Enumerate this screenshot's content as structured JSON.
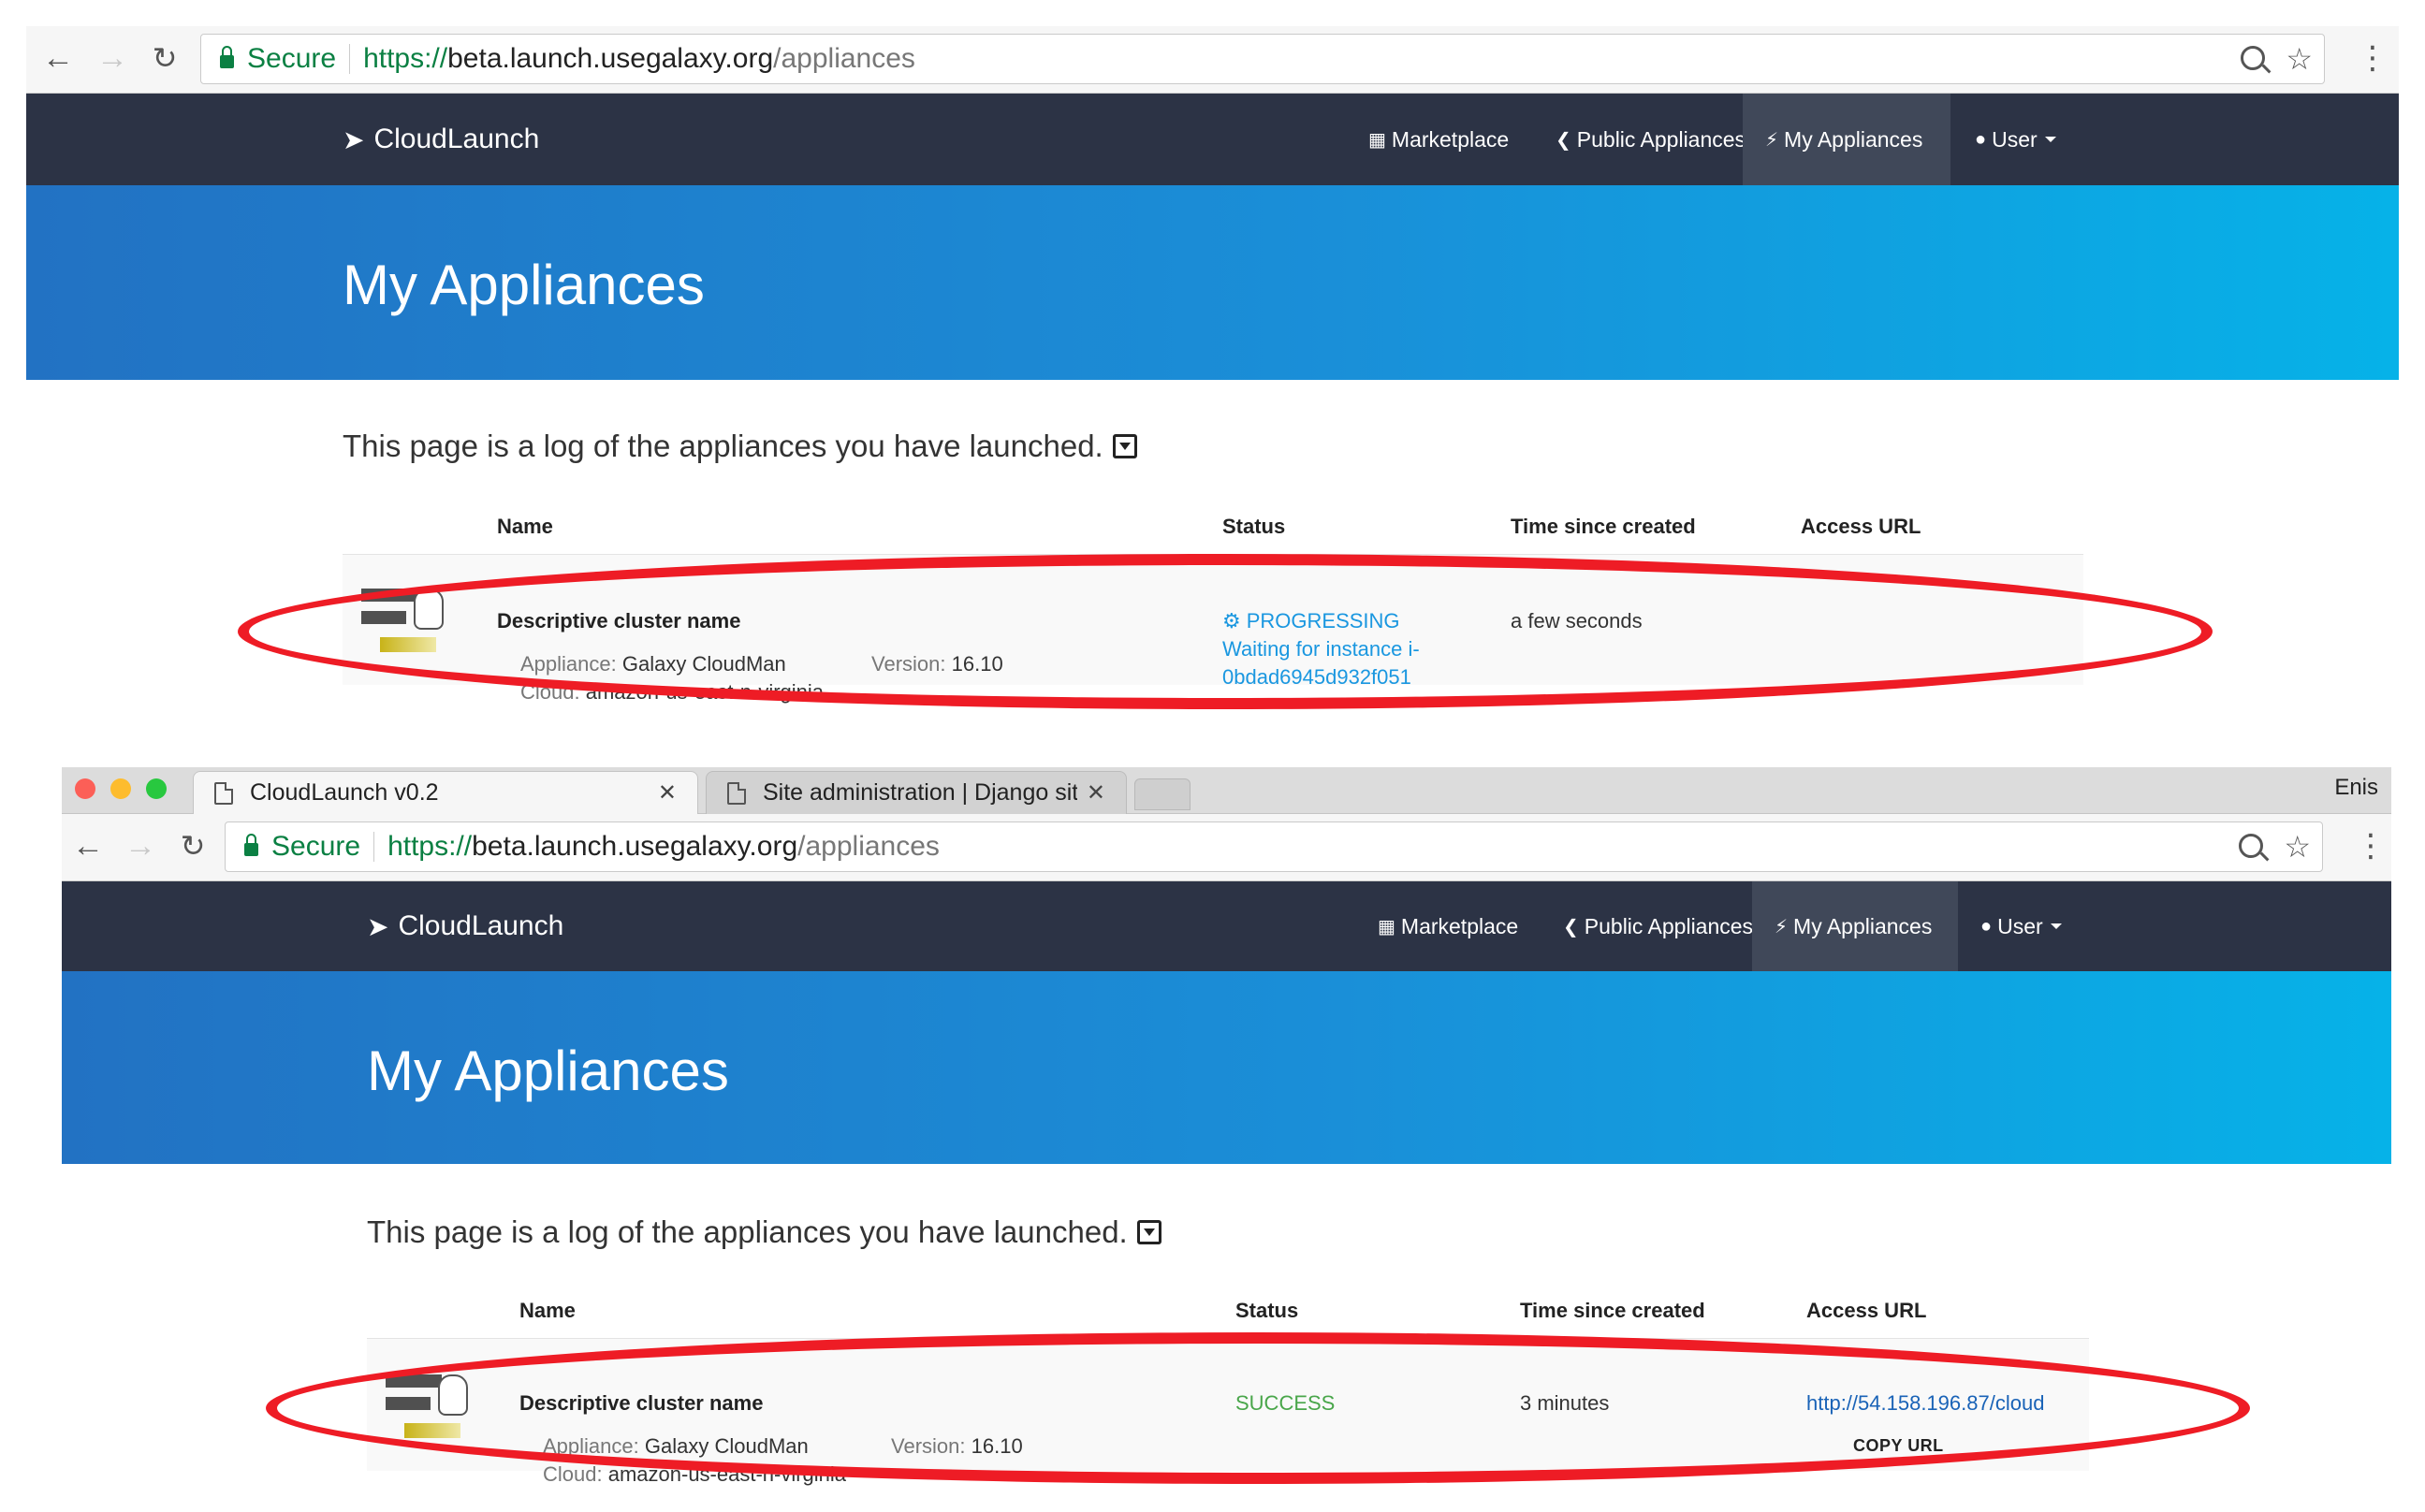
{
  "screenshots": [
    {
      "browser": {
        "secure_label": "Secure",
        "url_scheme": "https://",
        "url_host": "beta.launch.usegalaxy.org",
        "url_path": "/appliances"
      },
      "navbar": {
        "brand": "CloudLaunch",
        "items": [
          {
            "label": "Marketplace"
          },
          {
            "label": "Public Appliances"
          },
          {
            "label": "My Appliances"
          },
          {
            "label": "User"
          }
        ]
      },
      "page_title": "My Appliances",
      "intro_text": "This page is a log of the appliances you have launched.",
      "table": {
        "headers": [
          "Name",
          "Status",
          "Time since created",
          "Access URL"
        ],
        "row": {
          "name": "Descriptive cluster name",
          "appliance_label": "Appliance:",
          "appliance_value": "Galaxy CloudMan",
          "version_label": "Version:",
          "version_value": "16.10",
          "cloud_label": "Cloud:",
          "cloud_value": "amazon-us-east-n-virginia",
          "status": "PROGRESSING",
          "status_detail_1": "Waiting for instance i-",
          "status_detail_2": "0bdad6945d932f051",
          "time": "a few seconds",
          "access_url": ""
        }
      }
    },
    {
      "tabs": [
        {
          "title": "CloudLaunch v0.2"
        },
        {
          "title": "Site administration | Django sit"
        }
      ],
      "profile_name": "Enis",
      "browser": {
        "secure_label": "Secure",
        "url_scheme": "https://",
        "url_host": "beta.launch.usegalaxy.org",
        "url_path": "/appliances"
      },
      "navbar": {
        "brand": "CloudLaunch",
        "items": [
          {
            "label": "Marketplace"
          },
          {
            "label": "Public Appliances"
          },
          {
            "label": "My Appliances"
          },
          {
            "label": "User"
          }
        ]
      },
      "page_title": "My Appliances",
      "intro_text": "This page is a log of the appliances you have launched.",
      "table": {
        "headers": [
          "Name",
          "Status",
          "Time since created",
          "Access URL"
        ],
        "row": {
          "name": "Descriptive cluster name",
          "appliance_label": "Appliance:",
          "appliance_value": "Galaxy CloudMan",
          "version_label": "Version:",
          "version_value": "16.10",
          "cloud_label": "Cloud:",
          "cloud_value": "amazon-us-east-n-virginia",
          "status": "SUCCESS",
          "time": "3 minutes",
          "access_url": "http://54.158.196.87/cloud",
          "copy_label": "COPY URL"
        }
      }
    }
  ],
  "colors": {
    "navbar_bg": "#2c3345",
    "hero_start": "#2272c3",
    "hero_end": "#06b2e8",
    "status_progress": "#1a97e0",
    "status_success": "#49a64a",
    "highlight": "#ee1c25"
  },
  "icons": [
    "back-arrow-icon",
    "forward-arrow-icon",
    "reload-icon",
    "lock-icon",
    "zoom-icon",
    "star-icon",
    "menu-icon",
    "rocket-icon",
    "shopping-bag-icon",
    "share-icon",
    "plug-icon",
    "user-icon",
    "caret-square-icon",
    "appliance-icon",
    "cog-icon",
    "document-icon",
    "close-icon"
  ]
}
